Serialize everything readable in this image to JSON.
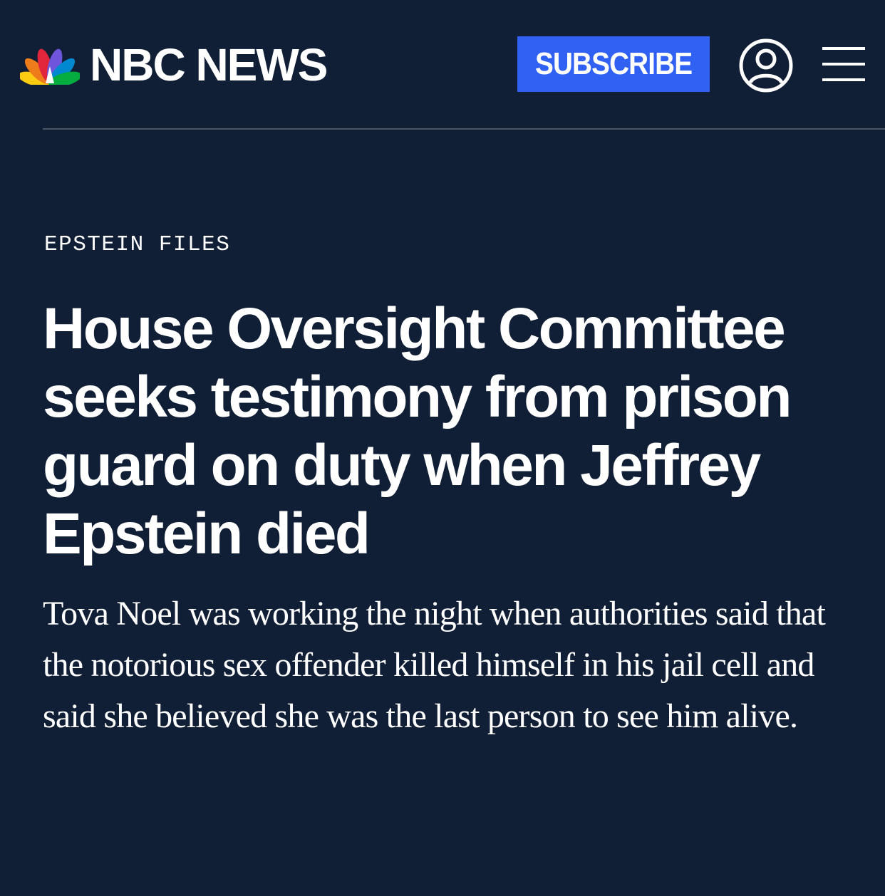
{
  "header": {
    "logo_text": "NBC NEWS",
    "subscribe_label": "SUBSCRIBE",
    "icons": {
      "logo": "nbc-peacock-icon",
      "account": "user-account-icon",
      "menu": "hamburger-menu-icon"
    }
  },
  "article": {
    "section_label": "EPSTEIN FILES",
    "headline": "House Oversight Committee seeks testimony from prison guard on duty when Jeffrey Epstein died",
    "dek": "Tova Noel was working the night when authorities said that the notorious sex offender killed himself in his jail cell and said she believed she was the last person to see him alive."
  },
  "colors": {
    "background": "#111f36",
    "subscribe_button": "#3061f2",
    "divider": "#4a5566",
    "text": "#ffffff"
  }
}
